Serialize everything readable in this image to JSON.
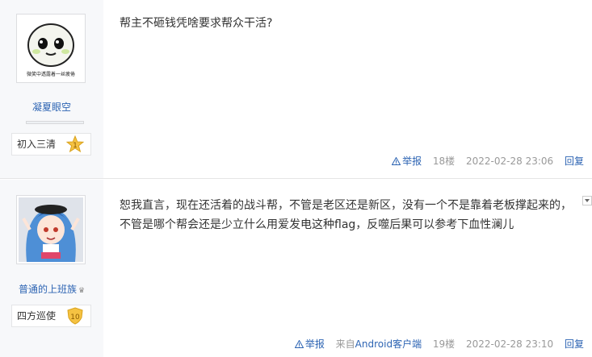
{
  "posts": [
    {
      "avatar_caption": "微笑中透露着一丝疲倦",
      "username": "凝夏眼空",
      "level_name": "初入三清",
      "level_num": "1",
      "content_lines": [
        "帮主不砸钱凭啥要求帮众干活?"
      ],
      "report": "举报",
      "floor": "18楼",
      "time": "2022-02-28 23:06",
      "reply": "回复"
    },
    {
      "username": "普通的上班族",
      "level_name": "四方巡使",
      "level_num": "10",
      "content_lines": [
        "恕我直言，现在还活着的战斗帮，不管是老区还是新区，没有一个不是靠着老板撑起来的，",
        "不管是哪个帮会还是少立什么用爱发电这种flag，反噬后果可以参考下血性澜儿"
      ],
      "report": "举报",
      "source_prefix": "来自",
      "source": "Android客户端",
      "floor": "19楼",
      "time": "2022-02-28 23:10",
      "reply": "回复"
    }
  ],
  "colors": {
    "link": "#2d64b3",
    "sidebar_bg": "#f7f8fa",
    "meta": "#999999",
    "badge_gold": "#f5c242"
  }
}
